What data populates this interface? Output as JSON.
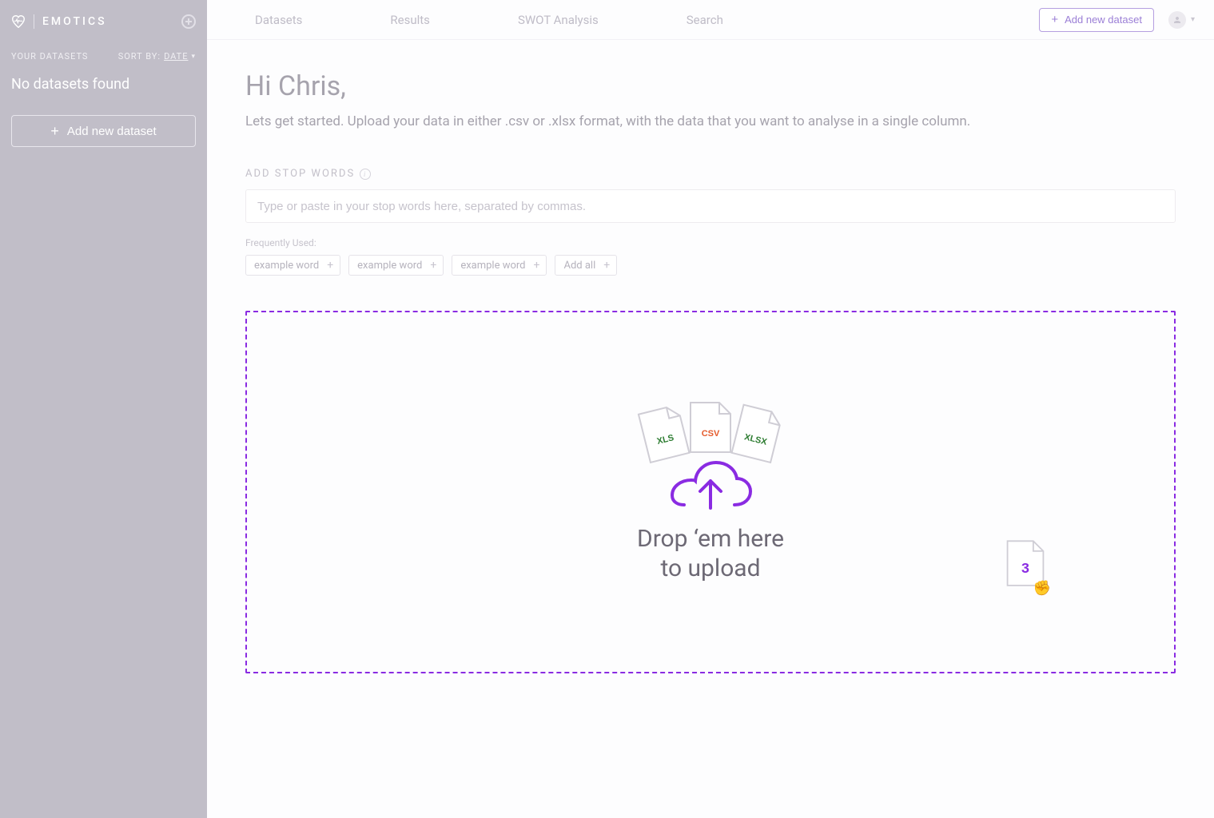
{
  "brand": {
    "name": "EMOTICS"
  },
  "sidebar": {
    "section_label": "YOUR DATASETS",
    "sort_prefix": "SORT BY:",
    "sort_value": "DATE",
    "empty_message": "No datasets found",
    "add_button": "Add new dataset"
  },
  "nav": {
    "items": [
      "Datasets",
      "Results",
      "SWOT Analysis",
      "Search"
    ]
  },
  "header": {
    "add_button": "Add new dataset"
  },
  "greet": {
    "title": "Hi Chris,",
    "intro": "Lets get started. Upload your data in either .csv or .xlsx format, with the data that you want to analyse in a single column."
  },
  "stopwords": {
    "label": "ADD STOP WORDS",
    "placeholder": "Type or paste in your stop words here, separated by commas.",
    "freq_label": "Frequently Used:",
    "chips": [
      "example word",
      "example word",
      "example word"
    ],
    "add_all": "Add all"
  },
  "dropzone": {
    "line1": "Drop ‘em here",
    "line2": "to upload",
    "file_types": {
      "xls": "XLS",
      "csv": "CSV",
      "xlsx": "XLSX"
    },
    "drag_count": "3"
  },
  "colors": {
    "accent": "#8a2be2"
  }
}
